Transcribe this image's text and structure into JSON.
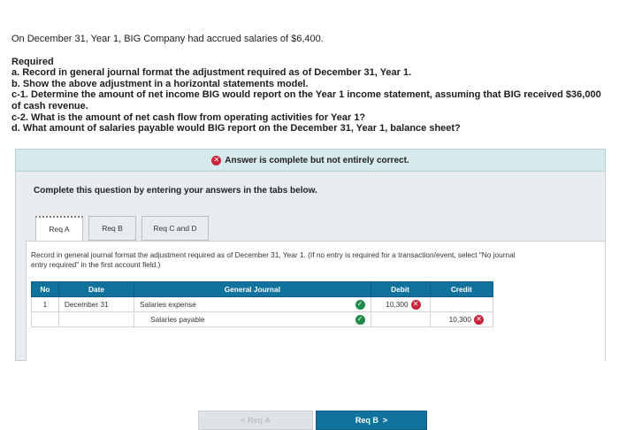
{
  "question": {
    "intro": "On December 31, Year 1, BIG Company had accrued salaries of $6,400.",
    "required_label": "Required",
    "items": [
      "a. Record in general journal format the adjustment required as of December 31, Year 1.",
      "b. Show the above adjustment in a horizontal statements model.",
      "c-1. Determine the amount of net income BIG would report on the Year 1 income statement, assuming that BIG received $36,000 of cash revenue.",
      "c-2. What is the amount of net cash flow from operating activities for Year 1?",
      "d. What amount of salaries payable would BIG report on the December 31, Year 1, balance sheet?"
    ]
  },
  "banner": {
    "text": "Answer is complete but not entirely correct.",
    "status_color": "#c8233c"
  },
  "panel": {
    "title": "Complete this question by entering your answers in the tabs below."
  },
  "tabs": [
    {
      "label": "Req A"
    },
    {
      "label": "Req B"
    },
    {
      "label": "Req C and D"
    }
  ],
  "instructions": "Record in general journal format the adjustment required as of December 31, Year 1. (If no entry is required for a transaction/event, select \"No journal entry required\" in the first account field.)",
  "journal": {
    "headers": {
      "no": "No",
      "date": "Date",
      "general_journal": "General Journal",
      "debit": "Debit",
      "credit": "Credit"
    },
    "rows": [
      {
        "no": "1",
        "date": "December 31",
        "account": "Salaries expense",
        "account_status": "correct",
        "debit": "10,300",
        "debit_status": "incorrect",
        "credit": ""
      },
      {
        "no": "",
        "date": "",
        "account": "Salaries payable",
        "account_status": "correct",
        "debit": "",
        "credit": "10,300",
        "credit_status": "incorrect"
      }
    ]
  },
  "nav": {
    "prev_label": "Req A",
    "next_label": "Req B"
  },
  "icons": {
    "incorrect": "x-circle-icon",
    "correct": "check-circle-icon",
    "next": "chevron-right-icon",
    "prev": "chevron-left-icon"
  },
  "colors": {
    "header_blue": "#12729e",
    "correct_green": "#1e8a4a",
    "incorrect_red": "#c8233c",
    "banner_bg": "#d6e9ec"
  }
}
